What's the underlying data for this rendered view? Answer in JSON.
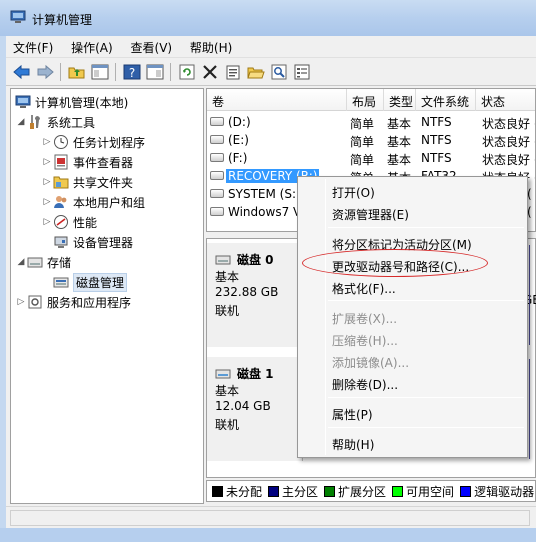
{
  "window": {
    "title": "计算机管理"
  },
  "menu": [
    "文件(F)",
    "操作(A)",
    "查看(V)",
    "帮助(H)"
  ],
  "tree": {
    "root": "计算机管理(本地)",
    "system_tools": "系统工具",
    "task_scheduler": "任务计划程序",
    "event_viewer": "事件查看器",
    "shared_folders": "共享文件夹",
    "local_users": "本地用户和组",
    "performance": "性能",
    "device_manager": "设备管理器",
    "storage": "存储",
    "disk_management": "磁盘管理",
    "services": "服务和应用程序"
  },
  "volumes": {
    "headers": [
      "卷",
      "布局",
      "类型",
      "文件系统",
      "状态"
    ],
    "rows": [
      {
        "name": "(D:)",
        "layout": "简单",
        "type": "基本",
        "fs": "NTFS",
        "status": "状态良好 ("
      },
      {
        "name": "(E:)",
        "layout": "简单",
        "type": "基本",
        "fs": "NTFS",
        "status": "状态良好 ("
      },
      {
        "name": "(F:)",
        "layout": "简单",
        "type": "基本",
        "fs": "NTFS",
        "status": "状态良好 ("
      },
      {
        "name": "RECOVERY (R:)",
        "layout": "简单",
        "type": "基本",
        "fs": "FAT32",
        "status": "状态良好 ("
      },
      {
        "name": "SYSTEM (S:)",
        "layout": "",
        "type": "",
        "fs": "",
        "status": "("
      },
      {
        "name": "Windows7 V",
        "layout": "",
        "type": "",
        "fs": "",
        "status": "("
      }
    ]
  },
  "disks": [
    {
      "name": "磁盘 0",
      "type": "基本",
      "size": "232.88 GB",
      "status": "联机",
      "tail": "GB"
    },
    {
      "name": "磁盘 1",
      "type": "基本",
      "size": "12.04 GB",
      "status": "联机",
      "tail": ""
    }
  ],
  "legend": [
    {
      "label": "未分配",
      "color": "#000000"
    },
    {
      "label": "主分区",
      "color": "#00007f"
    },
    {
      "label": "扩展分区",
      "color": "#008000"
    },
    {
      "label": "可用空间",
      "color": "#00ff00"
    },
    {
      "label": "逻辑驱动器",
      "color": "#0000ff"
    }
  ],
  "context_menu": {
    "open": "打开(O)",
    "explorer": "资源管理器(E)",
    "mark_active": "将分区标记为活动分区(M)",
    "change_letter": "更改驱动器号和路径(C)...",
    "format": "格式化(F)...",
    "extend": "扩展卷(X)...",
    "shrink": "压缩卷(H)...",
    "add_mirror": "添加镜像(A)...",
    "delete": "删除卷(D)...",
    "properties": "属性(P)",
    "help": "帮助(H)"
  },
  "colors": {
    "selection": "#3399ff",
    "highlight_ring": "#d62a2a"
  }
}
